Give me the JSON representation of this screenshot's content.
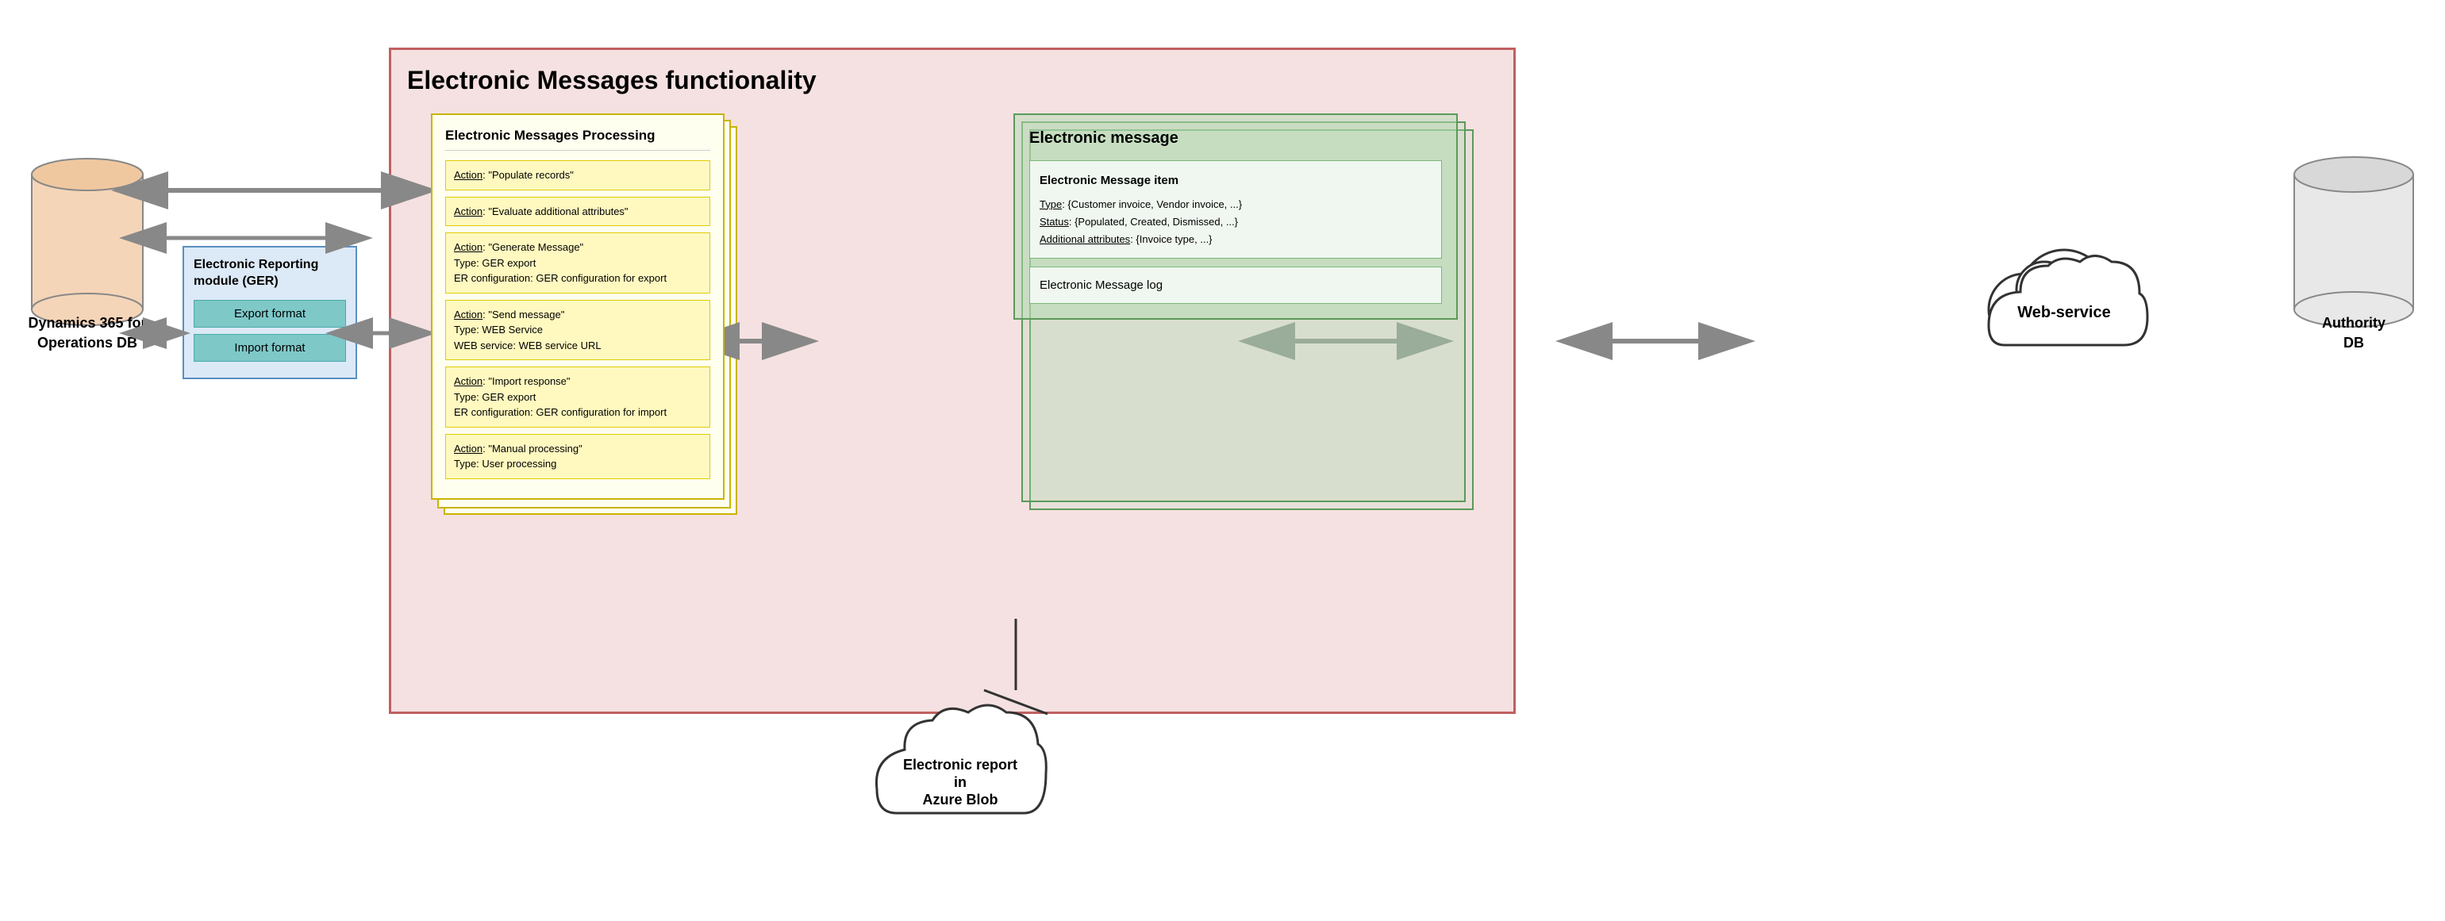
{
  "dynamics_db": {
    "label": "Dynamics 365\nfor Operations\nDB"
  },
  "er_module": {
    "title": "Electronic Reporting\nmodule (GER)",
    "export_btn": "Export format",
    "import_btn": "Import format"
  },
  "em_functionality": {
    "title": "Electronic Messages functionality",
    "processing": {
      "title": "Electronic Messages Processing",
      "actions": [
        {
          "title": "Action: \"Populate records\""
        },
        {
          "title": "Action: \"Evaluate additional attributes\""
        },
        {
          "title": "Action: \"Generate Message\"",
          "line2": "Type: GER export",
          "line3": "ER configuration: GER configuration for export"
        },
        {
          "title": "Action: \"Send message\"",
          "line2": "Type: WEB Service",
          "line3": "WEB service: WEB service URL"
        },
        {
          "title": "Action: \"Import response\"",
          "line2": "Type: GER export",
          "line3": "ER configuration: GER configuration for import"
        },
        {
          "title": "Action: \"Manual processing\"",
          "line2": "Type: User processing"
        }
      ]
    },
    "em_message": {
      "title": "Electronic message",
      "item": {
        "title": "Electronic Message item",
        "type_label": "Type:",
        "type_value": "{Customer invoice, Vendor invoice, ...}",
        "status_label": "Status:",
        "status_value": "{Populated, Created, Dismissed, ...}",
        "additional_label": "Additional attributes:",
        "additional_value": "{Invoice type, ...}"
      },
      "log_label": "Electronic Message log"
    }
  },
  "webservice": {
    "label": "Web-service"
  },
  "authority_db": {
    "label": "Authority\nDB"
  },
  "azure_blob": {
    "line1": "Electronic report",
    "line2": "in",
    "line3": "Azure Blob"
  }
}
